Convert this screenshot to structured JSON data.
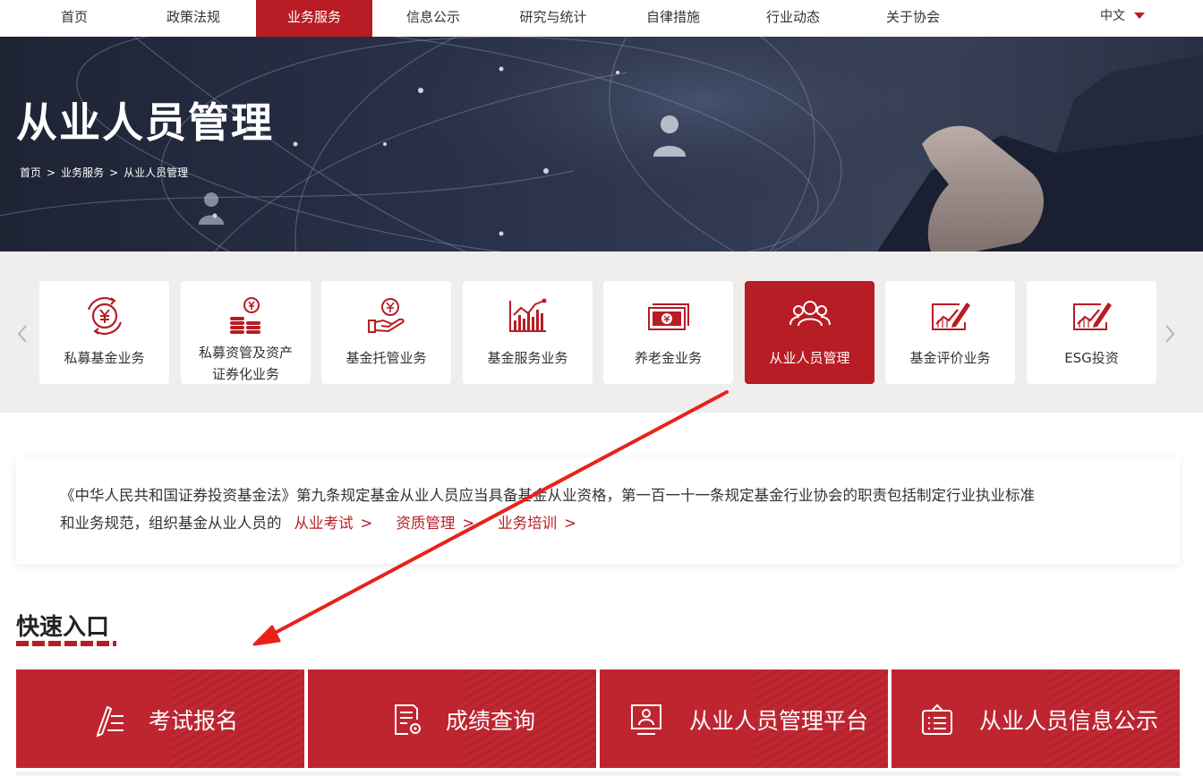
{
  "nav": {
    "items": [
      {
        "label": "首页",
        "active": false
      },
      {
        "label": "政策法规",
        "active": false
      },
      {
        "label": "业务服务",
        "active": true
      },
      {
        "label": "信息公示",
        "active": false
      },
      {
        "label": "研究与统计",
        "active": false
      },
      {
        "label": "自律措施",
        "active": false
      },
      {
        "label": "行业动态",
        "active": false
      },
      {
        "label": "关于协会",
        "active": false
      }
    ],
    "language": "中文"
  },
  "banner": {
    "title": "从业人员管理",
    "breadcrumb": [
      "首页",
      "业务服务",
      "从业人员管理"
    ],
    "breadcrumb_separator": ">"
  },
  "categories": {
    "prev_icon": "chevron-left-icon",
    "next_icon": "chevron-right-icon",
    "items": [
      {
        "label": "私募基金业务",
        "icon": "yen-cycle-icon",
        "active": false
      },
      {
        "label_line1": "私募资管及资产",
        "label_line2": "证券化业务",
        "icon": "coin-stack-icon",
        "active": false
      },
      {
        "label": "基金托管业务",
        "icon": "hand-coin-icon",
        "active": false
      },
      {
        "label": "基金服务业务",
        "icon": "bar-chart-icon",
        "active": false
      },
      {
        "label": "养老金业务",
        "icon": "banknotes-icon",
        "active": false
      },
      {
        "label": "从业人员管理",
        "icon": "people-icon",
        "active": true
      },
      {
        "label": "基金评价业务",
        "icon": "chart-pen-icon",
        "active": false
      },
      {
        "label": "ESG投资",
        "icon": "chart-pen-icon",
        "active": false
      }
    ]
  },
  "intro": {
    "text_line1": "《中华人民共和国证券投资基金法》第九条规定基金从业人员应当具备基金从业资格，第一百一十一条规定基金行业协会的职责包括制定行业执业标准",
    "text_line2": "和业务规范，组织基金从业人员的",
    "links": [
      "从业考试",
      "资质管理",
      "业务培训"
    ],
    "link_arrow": ">"
  },
  "quick_entry": {
    "title": "快速入口",
    "buttons": [
      {
        "label": "考试报名",
        "icon": "pen-ruler-icon"
      },
      {
        "label": "成绩查询",
        "icon": "document-gear-icon"
      },
      {
        "label": "从业人员管理平台",
        "icon": "id-card-icon"
      },
      {
        "label": "从业人员信息公示",
        "icon": "notice-board-icon"
      }
    ]
  },
  "colors": {
    "accent": "#b81c24",
    "banner_dark": "#1e2434",
    "strip_bg": "#f0eeec",
    "annotation_arrow": "#e8221b"
  }
}
